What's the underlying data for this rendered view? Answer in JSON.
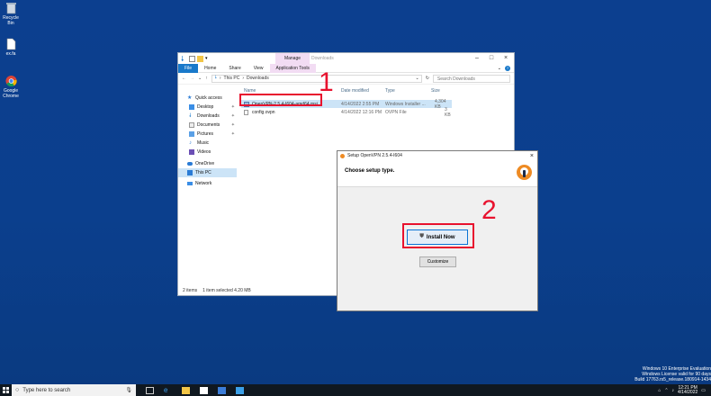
{
  "desktop": {
    "icons": [
      {
        "label": "Recycle Bin",
        "icon": "recycle-bin-icon"
      },
      {
        "label": "ex.fa",
        "icon": "file-icon"
      },
      {
        "label": "Google Chrome",
        "icon": "chrome-icon"
      }
    ],
    "watermark": [
      "Windows 10 Enterprise Evaluation",
      "Windows License valid for 90 days",
      "Build 17763.rs5_release.180914-1434"
    ]
  },
  "explorer": {
    "manage_tab": "Manage",
    "title": "Downloads",
    "ribbon_tabs": [
      "File",
      "Home",
      "Share",
      "View",
      "Application Tools"
    ],
    "breadcrumb": [
      "This PC",
      "Downloads"
    ],
    "search_placeholder": "Search Downloads",
    "nav": [
      {
        "label": "Quick access",
        "icon": "star-icon",
        "pinned": false
      },
      {
        "label": "Desktop",
        "icon": "desktop-icon",
        "pinned": true
      },
      {
        "label": "Downloads",
        "icon": "download-icon",
        "pinned": true
      },
      {
        "label": "Documents",
        "icon": "documents-icon",
        "pinned": true
      },
      {
        "label": "Pictures",
        "icon": "pictures-icon",
        "pinned": true
      },
      {
        "label": "Music",
        "icon": "music-icon",
        "pinned": false
      },
      {
        "label": "Videos",
        "icon": "videos-icon",
        "pinned": false
      },
      {
        "label": "OneDrive",
        "icon": "onedrive-icon",
        "pinned": false
      },
      {
        "label": "This PC",
        "icon": "pc-icon",
        "pinned": false
      },
      {
        "label": "Network",
        "icon": "network-icon",
        "pinned": false
      }
    ],
    "columns": [
      "Name",
      "Date modified",
      "Type",
      "Size"
    ],
    "files": [
      {
        "name": "OpenVPN-2.5.4-I604-amd64.msi",
        "date": "4/14/2022 2:55 PM",
        "type": "Windows Installer ...",
        "size": "4,304 KB"
      },
      {
        "name": "config.ovpn",
        "date": "4/14/2022 12:16 PM",
        "type": "OVPN File",
        "size": "3 KB"
      }
    ],
    "status": [
      "2 items",
      "1 item selected  4.20 MB"
    ]
  },
  "setup": {
    "title": "Setup OpenVPN 2.5.4-I604",
    "heading": "Choose setup type.",
    "install_label": "Install Now",
    "customize_label": "Customize"
  },
  "annotations": {
    "step1": "1",
    "step2": "2",
    "color": "#e8122e"
  },
  "taskbar": {
    "search_placeholder": "Type here to search",
    "time": "12:21 PM",
    "date": "4/14/2022"
  }
}
